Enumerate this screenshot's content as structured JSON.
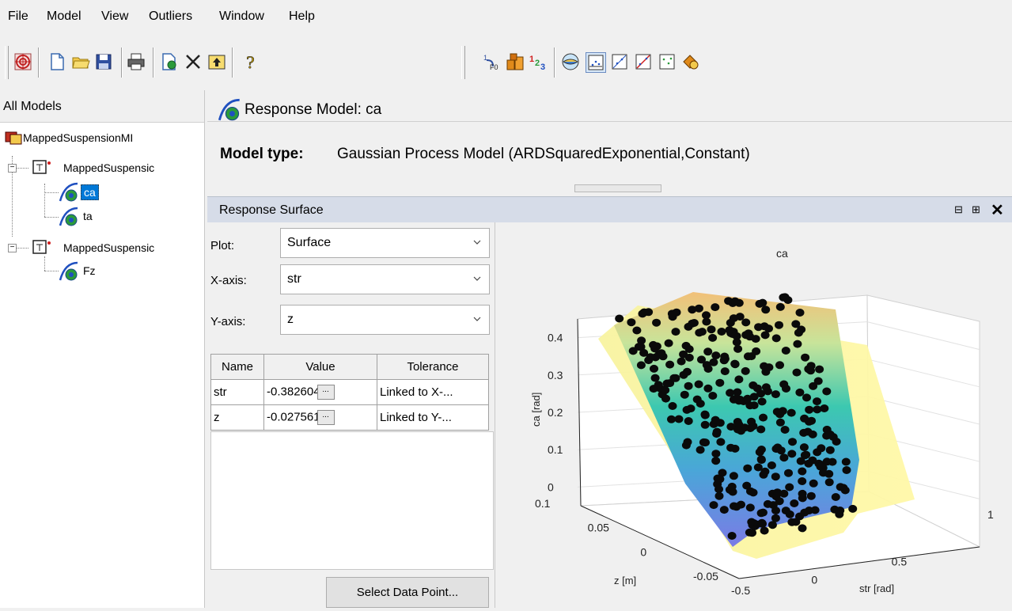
{
  "menubar": {
    "items": [
      "File",
      "Model",
      "View",
      "Outliers",
      "Window",
      "Help"
    ]
  },
  "toolbar": {
    "icons": [
      "target-icon",
      "new-icon",
      "open-icon",
      "save-icon",
      "print-icon",
      "new-child-icon",
      "delete-icon",
      "up-level-icon",
      "help-icon",
      "evaluate-icon",
      "blocks-icon",
      "numbers-icon",
      "model-view-icon",
      "residual-plot-icon",
      "scatter-plot-icon",
      "regression-plot-icon",
      "residuals-icon",
      "data-icon"
    ]
  },
  "tree": {
    "header": "All Models",
    "items": [
      {
        "label": "MappedSuspensionMI"
      },
      {
        "label": "MappedSuspensic"
      },
      {
        "label": "ca",
        "selected": true
      },
      {
        "label": "ta"
      },
      {
        "label": "MappedSuspensic"
      },
      {
        "label": "Fz"
      }
    ]
  },
  "response_model": {
    "title": "Response Model: ca",
    "model_type_label": "Model type:",
    "model_type_value": "Gaussian Process Model (ARDSquaredExponential,Constant)"
  },
  "surface_panel": {
    "title": "Response Surface",
    "plot_label": "Plot:",
    "plot_value": "Surface",
    "xaxis_label": "X-axis:",
    "xaxis_value": "str",
    "yaxis_label": "Y-axis:",
    "yaxis_value": "z",
    "table": {
      "headers": [
        "Name",
        "Value",
        "Tolerance"
      ],
      "rows": [
        {
          "name": "str",
          "value": "-0.382604",
          "tolerance": "Linked to X-..."
        },
        {
          "name": "z",
          "value": "-0.027561",
          "tolerance": "Linked to Y-..."
        }
      ]
    },
    "select_button": "Select Data Point..."
  },
  "chart_data": {
    "type": "surface",
    "title": "ca",
    "xlabel": "str [rad]",
    "ylabel": "z [m]",
    "zlabel": "ca [rad]",
    "x_ticks": [
      "-0.5",
      "0",
      "0.5",
      "1"
    ],
    "y_ticks": [
      "-0.05",
      "0",
      "0.05",
      "0.1"
    ],
    "z_ticks": [
      "0",
      "0.1",
      "0.2",
      "0.3",
      "0.4"
    ],
    "zlim": [
      -0.05,
      0.45
    ]
  }
}
